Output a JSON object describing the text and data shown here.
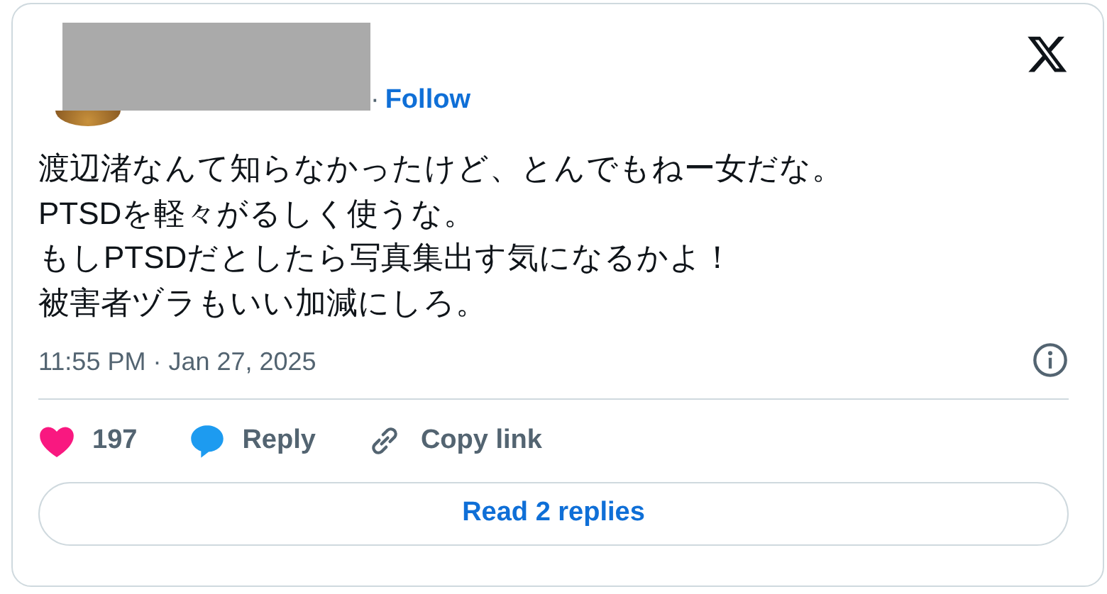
{
  "author": {
    "separator": "·",
    "follow": "Follow"
  },
  "tweet": {
    "lines": [
      "渡辺渚なんて知らなかったけど、とんでもねー女だな。",
      "PTSDを軽々がるしく使うな。",
      "もしPTSDだとしたら写真集出す気になるかよ！",
      "被害者ヅラもいい加減にしろ。"
    ],
    "timestamp": "11:55 PM · Jan 27, 2025"
  },
  "actions": [
    {
      "kind": "like",
      "label": "197"
    },
    {
      "kind": "reply",
      "label": "Reply"
    },
    {
      "kind": "copy",
      "label": "Copy link"
    }
  ],
  "read_replies": "Read 2 replies"
}
